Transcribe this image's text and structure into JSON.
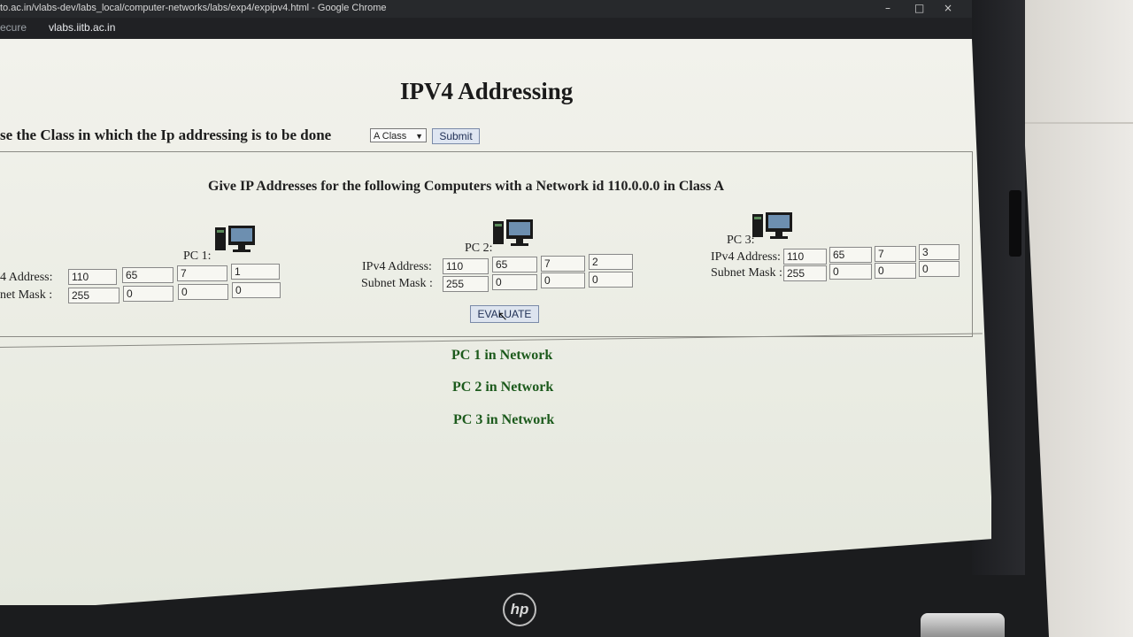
{
  "browser": {
    "title": "to.ac.in/vlabs-dev/labs_local/computer-networks/labs/exp4/expipv4.html - Google Chrome",
    "security": "ecure",
    "host": "vlabs.iitb.ac.in",
    "window_controls": {
      "minimize": "–",
      "maximize": "□",
      "close": "×"
    }
  },
  "page": {
    "title": "IPV4 Addressing",
    "class_prompt": "se the Class in which the Ip addressing is to be done",
    "class_select_value": "A Class",
    "submit_label": "Submit",
    "heading": "Give IP Addresses for the following Computers with a Network id 110.0.0.0 in Class A",
    "evaluate_label": "EVALUATE"
  },
  "pcs": [
    {
      "label": "PC 1:",
      "addr_label": "4 Address:",
      "mask_label": "net Mask :",
      "ip": [
        "110",
        "65",
        "7",
        "1"
      ],
      "mask": [
        "255",
        "0",
        "0",
        "0"
      ]
    },
    {
      "label": "PC 2:",
      "addr_label": "IPv4 Address:",
      "mask_label": "Subnet Mask :",
      "ip": [
        "110",
        "65",
        "7",
        "2"
      ],
      "mask": [
        "255",
        "0",
        "0",
        "0"
      ]
    },
    {
      "label": "PC 3:",
      "addr_label": "IPv4 Address:",
      "mask_label": "Subnet Mask :",
      "ip": [
        "110",
        "65",
        "7",
        "3"
      ],
      "mask": [
        "255",
        "0",
        "0",
        "0"
      ]
    }
  ],
  "results": [
    "PC 1 in Network",
    "PC 2 in Network",
    "PC 3 in Network"
  ],
  "laptop": {
    "brand": "hp"
  },
  "icons": {
    "pc": "desktop-computer-icon",
    "dropdown": "chevron-down-icon"
  },
  "colors": {
    "result_text": "#1c5a1c",
    "button_bg": "#dfe6f2"
  }
}
